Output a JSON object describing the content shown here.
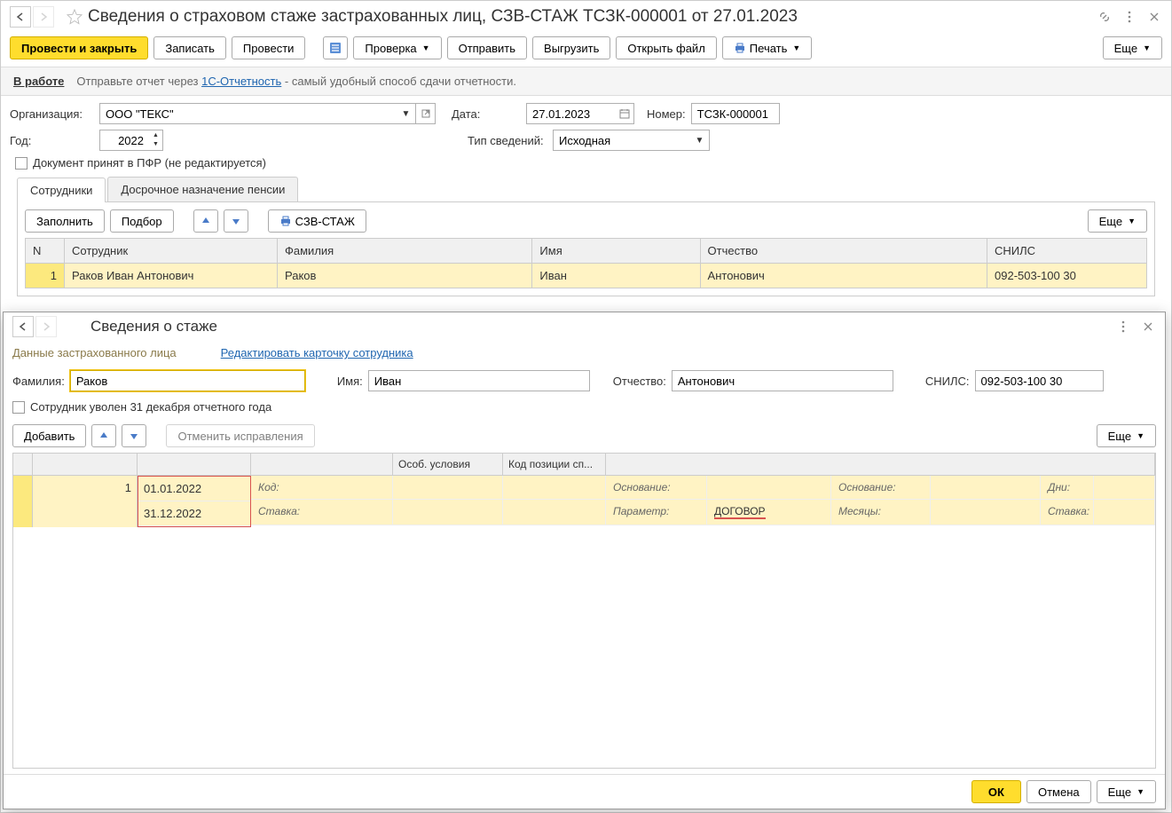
{
  "title": "Сведения о страховом стаже застрахованных лиц, СЗВ-СТАЖ ТСЗК-000001 от 27.01.2023",
  "toolbar": {
    "post_close": "Провести и закрыть",
    "write": "Записать",
    "post": "Провести",
    "check": "Проверка",
    "send": "Отправить",
    "upload": "Выгрузить",
    "open_file": "Открыть файл",
    "print": "Печать",
    "more": "Еще"
  },
  "info": {
    "status": "В работе",
    "text_before": "Отправьте отчет через ",
    "link": "1С-Отчетность",
    "text_after": " - самый удобный способ сдачи отчетности."
  },
  "form": {
    "org_label": "Организация:",
    "org_value": "ООО \"ТЕКС\"",
    "date_label": "Дата:",
    "date_value": "27.01.2023",
    "number_label": "Номер:",
    "number_value": "ТСЗК-000001",
    "year_label": "Год:",
    "year_value": "2022",
    "type_label": "Тип сведений:",
    "type_value": "Исходная",
    "accepted_label": "Документ принят в ПФР (не редактируется)"
  },
  "tabs": {
    "employees": "Сотрудники",
    "pension": "Досрочное назначение пенсии"
  },
  "emp_toolbar": {
    "fill": "Заполнить",
    "pick": "Подбор",
    "szv": "СЗВ-СТАЖ",
    "more": "Еще"
  },
  "emp_table": {
    "headers": {
      "n": "N",
      "emp": "Сотрудник",
      "last": "Фамилия",
      "first": "Имя",
      "mid": "Отчество",
      "snils": "СНИЛС"
    },
    "row": {
      "n": "1",
      "emp": "Раков Иван Антонович",
      "last": "Раков",
      "first": "Иван",
      "mid": "Антонович",
      "snils": "092-503-100 30"
    }
  },
  "overlay": {
    "title": "Сведения о стаже",
    "section": "Данные застрахованного лица",
    "edit_link": "Редактировать карточку сотрудника",
    "last_label": "Фамилия:",
    "last_value": "Раков",
    "first_label": "Имя:",
    "first_value": "Иван",
    "mid_label": "Отчество:",
    "mid_value": "Антонович",
    "snils_label": "СНИЛС:",
    "snils_value": "092-503-100 30",
    "dismissed_label": "Сотрудник уволен 31 декабря отчетного года",
    "add": "Добавить",
    "cancel_fix": "Отменить исправления",
    "more": "Еще",
    "grid_headers": {
      "cond": "Особ. условия",
      "poscode": "Код позиции сп..."
    },
    "period": {
      "n": "1",
      "start": "01.01.2022",
      "end": "31.12.2022",
      "code_lbl": "Код:",
      "rate_lbl": "Ставка:",
      "basis_lbl": "Основание:",
      "param_lbl": "Параметр:",
      "param_val": "ДОГОВОР",
      "basis2_lbl": "Основание:",
      "months_lbl": "Месяцы:",
      "days_lbl": "Дни:",
      "rate2_lbl": "Ставка:"
    },
    "ok": "ОК",
    "cancel": "Отмена",
    "more2": "Еще"
  }
}
